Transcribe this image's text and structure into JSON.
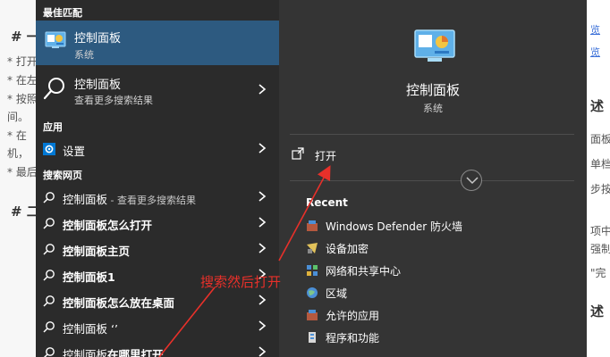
{
  "background_doc": {
    "left_lines": [
      "# 一",
      "* 打开",
      "* 在左",
      "* 按照",
      "间。",
      "* 在",
      "机，",
      "* 最后",
      "# 二"
    ],
    "right_lines": [
      "述",
      "面板",
      "单档",
      "步按",
      "项中",
      "强制",
      "\"完",
      "述"
    ],
    "right_links": [
      "览",
      "览"
    ]
  },
  "left_pane": {
    "best_match_label": "最佳匹配",
    "best_match": {
      "title": "控制面板",
      "subtitle": "系统"
    },
    "search_row": {
      "title": "控制面板",
      "subtitle": "查看更多搜索结果"
    },
    "apps_label": "应用",
    "apps": [
      {
        "label": "设置"
      }
    ],
    "web_label": "搜索网页",
    "web_results": [
      {
        "bold": "控制面板",
        "rest": " - 查看更多搜索结果"
      },
      {
        "bold": "控制面板怎么打开",
        "rest": ""
      },
      {
        "bold": "控制面板主页",
        "rest": ""
      },
      {
        "bold": "控制面板1",
        "rest": ""
      },
      {
        "bold": "控制面板怎么放在桌面",
        "rest": ""
      },
      {
        "bold": "控制面板",
        "rest": " ‘’"
      },
      {
        "bold": "控制面板在哪里打开",
        "rest": ""
      }
    ]
  },
  "right_pane": {
    "title": "控制面板",
    "subtitle": "系统",
    "open_label": "打开",
    "recent_label": "Recent",
    "recent": [
      {
        "label": "Windows Defender 防火墙",
        "icon": "firewall-icon"
      },
      {
        "label": "设备加密",
        "icon": "encryption-icon"
      },
      {
        "label": "网络和共享中心",
        "icon": "network-icon"
      },
      {
        "label": "区域",
        "icon": "region-icon"
      },
      {
        "label": "允许的应用",
        "icon": "allowed-apps-icon"
      },
      {
        "label": "程序和功能",
        "icon": "programs-icon"
      }
    ]
  },
  "annotation": {
    "text": "搜索然后打开",
    "color": "#e8302a"
  },
  "colors": {
    "menu_bg": "#2b2b2b",
    "right_bg": "#343434",
    "highlight": "#2d5a80",
    "accent": "#0078d4"
  }
}
